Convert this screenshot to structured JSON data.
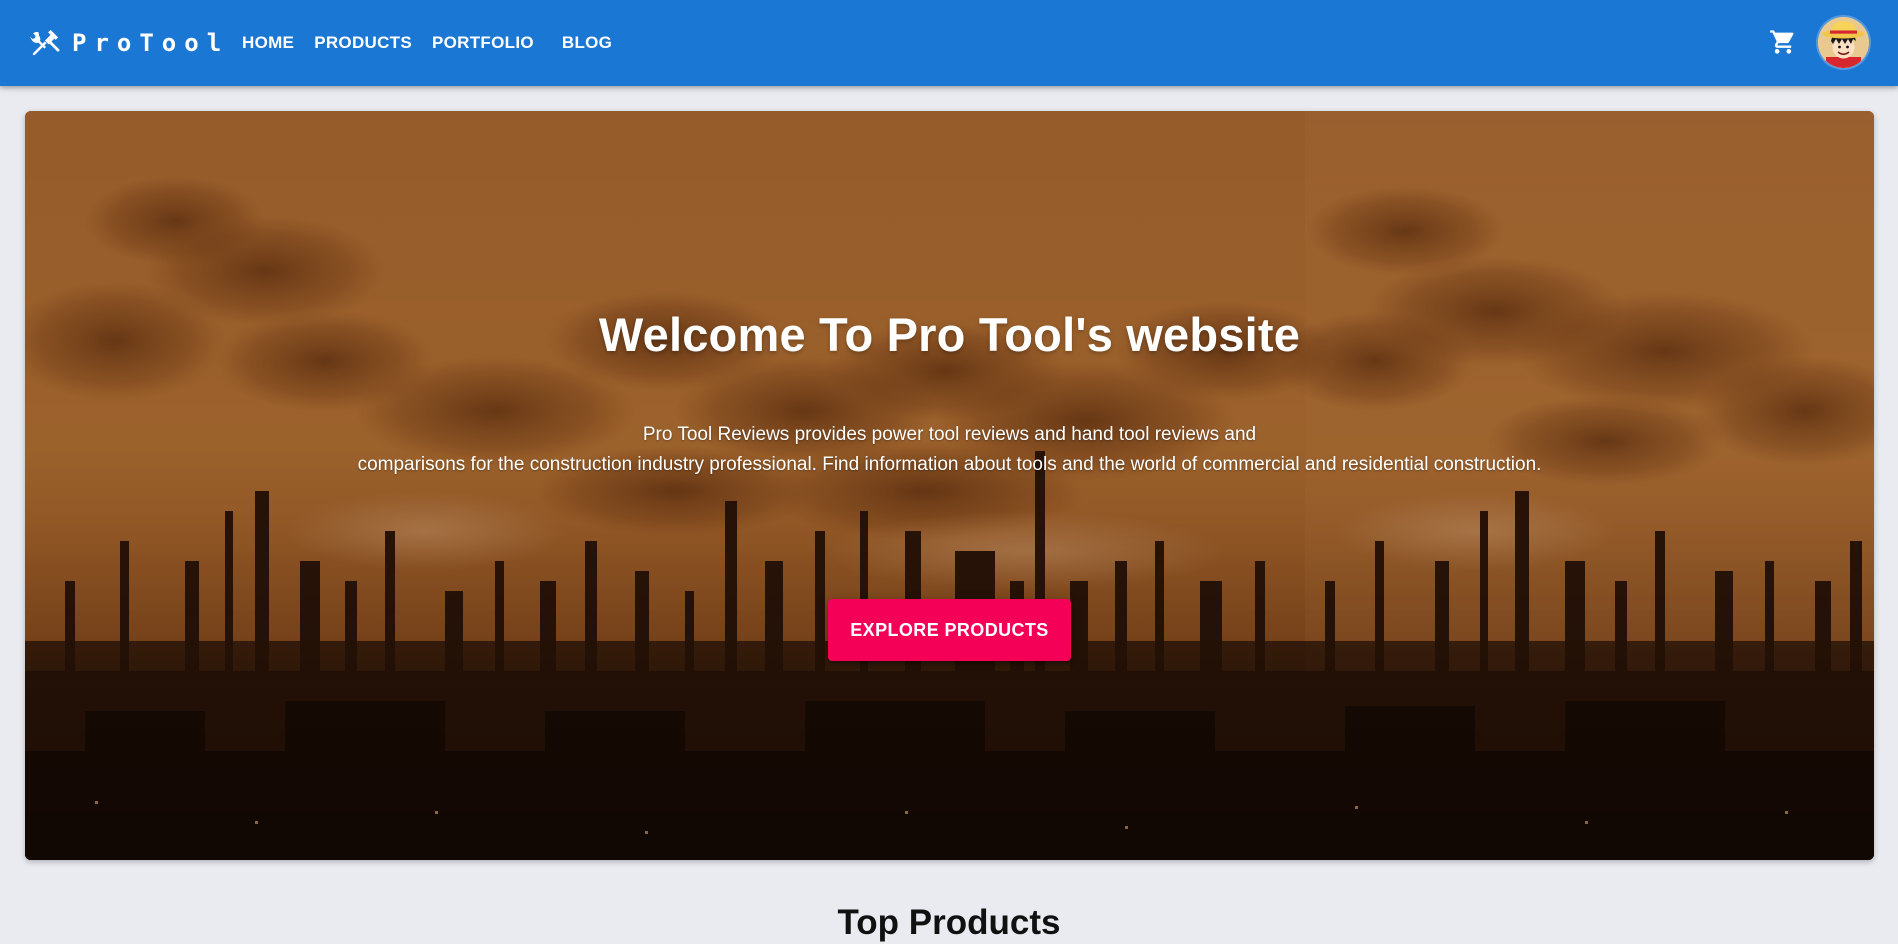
{
  "header": {
    "brand": "ProTool",
    "brand_icon": "tools-icon",
    "nav": [
      "HOME",
      "PRODUCTS",
      "PORTFOLIO",
      "BLOG"
    ],
    "cart_icon": "shopping-cart-icon",
    "avatar_icon": "user-avatar",
    "bar_color": "#1b77d4"
  },
  "hero": {
    "title": "Welcome To Pro Tool's website",
    "description_line1": "Pro Tool Reviews provides power tool reviews and hand tool reviews and",
    "description_line2": "comparisons for the construction industry professional. Find information about tools and the world of commercial and residential construction.",
    "cta_label": "EXPLORE PRODUCTS",
    "cta_color": "#f50057"
  },
  "sections": {
    "top_products_title": "Top Products"
  }
}
